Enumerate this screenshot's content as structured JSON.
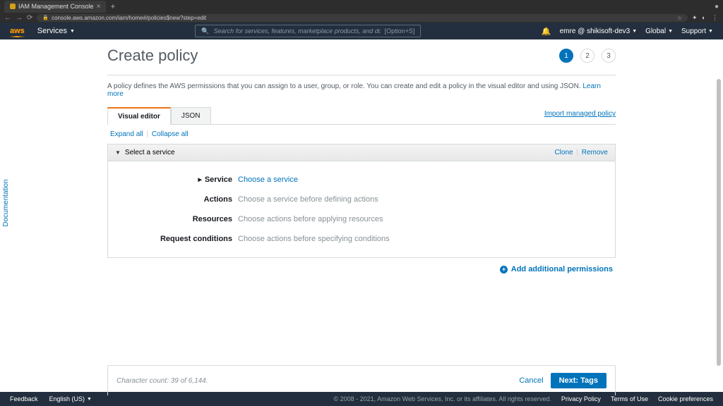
{
  "browser": {
    "tab_title": "IAM Management Console",
    "url": "console.aws.amazon.com/iam/home#/policies$new?step=edit"
  },
  "header": {
    "services": "Services",
    "search_placeholder": "Search for services, features, marketplace products, and docs",
    "search_shortcut": "[Option+S]",
    "user": "emre @ shikisoft-dev3",
    "region": "Global",
    "support": "Support"
  },
  "doc_tab": "Documentation",
  "page": {
    "title": "Create policy",
    "steps": [
      "1",
      "2",
      "3"
    ],
    "active_step": 0,
    "description": "A policy defines the AWS permissions that you can assign to a user, group, or role. You can create and edit a policy in the visual editor and using JSON.",
    "learn_more": "Learn more",
    "tabs": {
      "visual": "Visual editor",
      "json": "JSON"
    },
    "import_link": "Import managed policy",
    "expand_all": "Expand all",
    "collapse_all": "Collapse all",
    "section": {
      "title": "Select a service",
      "clone": "Clone",
      "remove": "Remove",
      "fields": {
        "service_label": "Service",
        "service_value": "Choose a service",
        "actions_label": "Actions",
        "actions_value": "Choose a service before defining actions",
        "resources_label": "Resources",
        "resources_value": "Choose actions before applying resources",
        "conditions_label": "Request conditions",
        "conditions_value": "Choose actions before specifying conditions"
      }
    },
    "add_perm": "Add additional permissions",
    "char_count": "Character count: 39 of 6,144.",
    "cancel": "Cancel",
    "next": "Next: Tags"
  },
  "footer": {
    "feedback": "Feedback",
    "language": "English (US)",
    "copyright": "© 2008 - 2021, Amazon Web Services, Inc. or its affiliates. All rights reserved.",
    "privacy": "Privacy Policy",
    "terms": "Terms of Use",
    "cookies": "Cookie preferences"
  }
}
